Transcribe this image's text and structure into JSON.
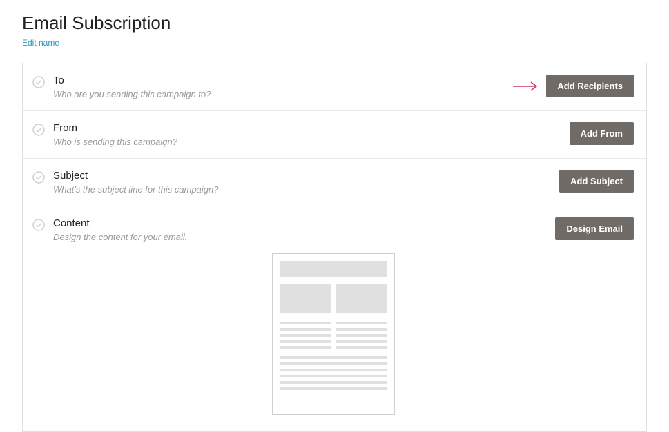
{
  "header": {
    "title": "Email Subscription",
    "edit_link": "Edit name"
  },
  "rows": {
    "to": {
      "title": "To",
      "desc": "Who are you sending this campaign to?",
      "button": "Add Recipients"
    },
    "from": {
      "title": "From",
      "desc": "Who is sending this campaign?",
      "button": "Add From"
    },
    "subject": {
      "title": "Subject",
      "desc": "What's the subject line for this campaign?",
      "button": "Add Subject"
    },
    "content": {
      "title": "Content",
      "desc": "Design the content for your email.",
      "button": "Design Email"
    }
  },
  "colors": {
    "button_bg": "#716b67",
    "accent_arrow": "#d6336c",
    "link": "#2c9ab7"
  }
}
